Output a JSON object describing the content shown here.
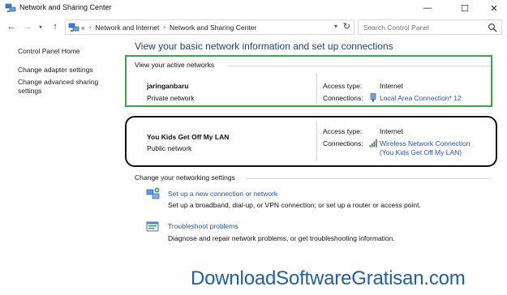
{
  "window": {
    "title": "Network and Sharing Center",
    "controls": {
      "minimize": "—",
      "maximize": "☐",
      "close": "✕"
    }
  },
  "nav": {
    "back": "←",
    "forward": "→",
    "recent": "▾",
    "up": "↑"
  },
  "address": {
    "overflow": "«",
    "separator": "›",
    "crumbs": [
      "Network and Internet",
      "Network and Sharing Center"
    ],
    "dropdown": "▾",
    "refresh": "↻"
  },
  "search": {
    "placeholder": "Search Control Panel"
  },
  "sidebar": {
    "items": [
      {
        "label": "Control Panel Home"
      },
      {
        "label": "Change adapter settings"
      },
      {
        "label": "Change advanced sharing settings"
      }
    ]
  },
  "main": {
    "heading": "View your basic network information and set up connections",
    "active_label": "View your active networks",
    "networks": [
      {
        "name": "jaringanbaru",
        "type": "Private network",
        "access_label": "Access type:",
        "access_value": "Internet",
        "connections_label": "Connections:",
        "connection_link": "Local Area Connection* 12"
      },
      {
        "name": "You Kids Get Off My LAN",
        "type": "Public network",
        "access_label": "Access type:",
        "access_value": "Internet",
        "connections_label": "Connections:",
        "connection_link_line1": "Wireless Network Connection",
        "connection_link_line2": "(You Kids Get Off My LAN)"
      }
    ],
    "change_label": "Change your networking settings",
    "tasks": [
      {
        "link": "Set up a new connection or network",
        "desc": "Set up a broadband, dial-up, or VPN connection; or set up a router or access point."
      },
      {
        "link": "Troubleshoot problems",
        "desc": "Diagnose and repair network problems, or get troubleshooting information."
      }
    ]
  },
  "watermark": "DownloadSoftwareGratisan.com",
  "colors": {
    "link": "#1f56b5",
    "heading": "#1e3f8a",
    "green_frame": "#3aa54a",
    "watermark": "#1f5ea8"
  }
}
